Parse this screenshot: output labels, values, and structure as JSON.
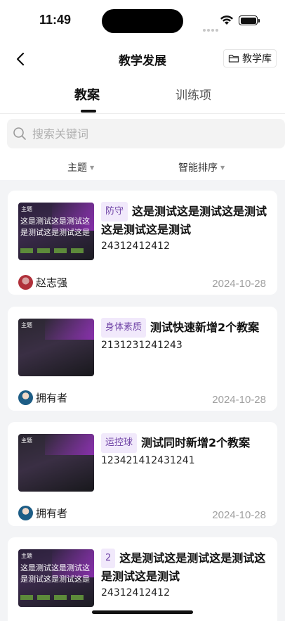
{
  "status": {
    "time": "11:49"
  },
  "nav": {
    "title": "教学发展",
    "library_label": "教学库"
  },
  "tabs": [
    {
      "label": "教案",
      "active": true
    },
    {
      "label": "训练项",
      "active": false
    }
  ],
  "search": {
    "placeholder": "搜索关键词"
  },
  "filters": {
    "topic_label": "主题",
    "sort_label": "智能排序"
  },
  "cards": [
    {
      "tag": "防守",
      "title": "这是测试这是测试这是测试这是测试这是测试",
      "code": "24312412412",
      "owner": "赵志强",
      "date": "2024-10-28",
      "thumb_label": "主题",
      "thumb_lines": [
        "这是测试这是测试这",
        "是测试这是测试这是"
      ]
    },
    {
      "tag": "身体素质",
      "title": "测试快速新增2个教案",
      "code": "2131231241243",
      "owner": "拥有者",
      "date": "2024-10-28",
      "thumb_label": "主题",
      "thumb_lines": []
    },
    {
      "tag": "运控球",
      "title": "测试同时新增2个教案",
      "code": "123421412431241",
      "owner": "拥有者",
      "date": "2024-10-28",
      "thumb_label": "主题",
      "thumb_lines": []
    },
    {
      "tag": "2",
      "title": "这是测试这是测试这是测试这是测试这是测试",
      "code": "24312412412",
      "owner": "",
      "date": "",
      "thumb_label": "主题",
      "thumb_lines": [
        "这是测试这是测试这",
        "是测试这是测试这是"
      ]
    }
  ],
  "colors": {
    "tag_bg": "#f1e9fb",
    "tag_text": "#6f43a6",
    "background": "#f3f4f6"
  }
}
